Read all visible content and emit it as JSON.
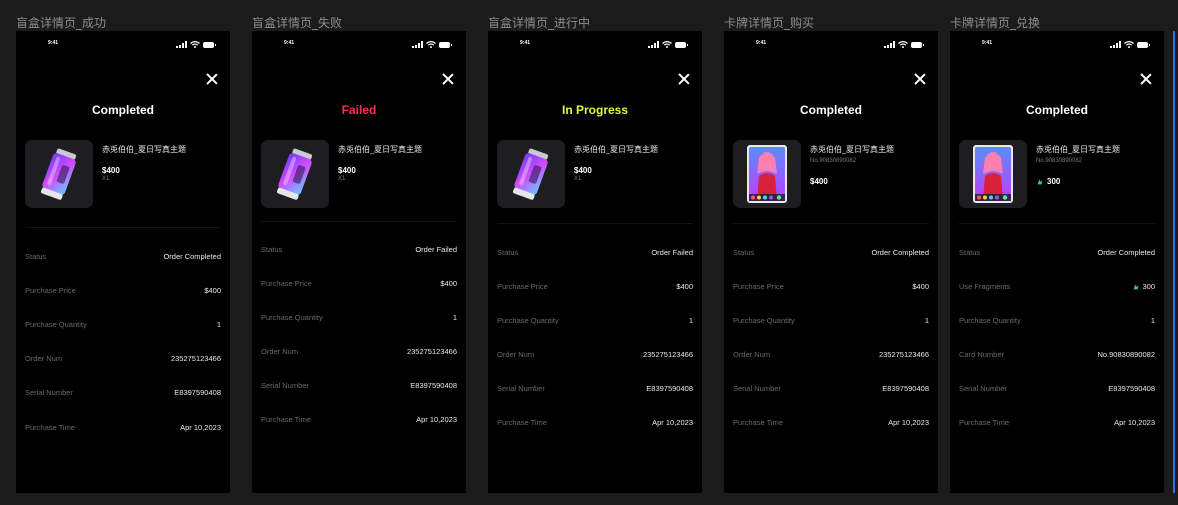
{
  "frames": [
    {
      "label": "盲盒详情页_成功",
      "time": "9:41",
      "title": "Completed",
      "title_color": "#ffffff",
      "product": {
        "image": "blind-box-can",
        "name": "赤兎伯伯_夏日写真主题",
        "no": "",
        "price": "$400",
        "price_icon": "",
        "qty": "X1"
      },
      "rows": [
        {
          "key": "Status",
          "value": "Order Completed"
        },
        {
          "key": "Purchase Price",
          "value": "$400"
        },
        {
          "key": "Purchase Quantity",
          "value": "1"
        },
        {
          "key": "Order Num",
          "value": "235275123466"
        },
        {
          "key": "Serial Number",
          "value": "E8397590408"
        },
        {
          "key": "Purchase Time",
          "value": "Apr 10,2023"
        }
      ]
    },
    {
      "label": "盲盒详情页_失败",
      "time": "9:41",
      "title": "Failed",
      "title_color": "#ff2d55",
      "product": {
        "image": "blind-box-can",
        "name": "赤兎伯伯_夏日写真主题",
        "no": "",
        "price": "$400",
        "price_icon": "",
        "qty": "X1"
      },
      "rows": [
        {
          "key": "Status",
          "value": "Order Failed"
        },
        {
          "key": "Purchase Price",
          "value": "$400"
        },
        {
          "key": "Purchase Quantity",
          "value": "1"
        },
        {
          "key": "Order Num",
          "value": "235275123466"
        },
        {
          "key": "Serial Number",
          "value": "E8397590408"
        },
        {
          "key": "Purchase Time",
          "value": "Apr 10,2023"
        }
      ]
    },
    {
      "label": "盲盒详情页_进行中",
      "time": "9:41",
      "title": "In Progress",
      "title_color": "#d9ff3a",
      "product": {
        "image": "blind-box-can",
        "name": "赤兎伯伯_夏日写真主题",
        "no": "",
        "price": "$400",
        "price_icon": "",
        "qty": "X1"
      },
      "rows": [
        {
          "key": "Status",
          "value": "Order Failed"
        },
        {
          "key": "Purchase Price",
          "value": "$400"
        },
        {
          "key": "Purchase Quantity",
          "value": "1"
        },
        {
          "key": "Order Num",
          "value": "235275123466"
        },
        {
          "key": "Serial Number",
          "value": "E8397590408"
        },
        {
          "key": "Purchase Time",
          "value": "Apr 10,2023"
        }
      ]
    },
    {
      "label": "卡牌详情页_购买",
      "time": "9:41",
      "title": "Completed",
      "title_color": "#ffffff",
      "product": {
        "image": "character-card",
        "name": "赤兎伯伯_夏日写真主题",
        "no": "No.90830890082",
        "price": "$400",
        "price_icon": "",
        "qty": ""
      },
      "rows": [
        {
          "key": "Status",
          "value": "Order Completed"
        },
        {
          "key": "Purchase Price",
          "value": "$400"
        },
        {
          "key": "Purchase Quantity",
          "value": "1"
        },
        {
          "key": "Order Num",
          "value": "235275123466"
        },
        {
          "key": "Serial Number",
          "value": "E8397590408"
        },
        {
          "key": "Purchase Time",
          "value": "Apr 10,2023"
        }
      ]
    },
    {
      "label": "卡牌详情页_兑换",
      "time": "9:41",
      "title": "Completed",
      "title_color": "#ffffff",
      "product": {
        "image": "character-card",
        "name": "赤兎伯伯_夏日写真主题",
        "no": "No.90830890082",
        "price": "300",
        "price_icon": "fragment-icon",
        "qty": ""
      },
      "rows": [
        {
          "key": "Status",
          "value": "Order Completed"
        },
        {
          "key": "Use Fragments",
          "value": "300",
          "icon": "fragment-icon"
        },
        {
          "key": "Purchase Quantity",
          "value": "1"
        },
        {
          "key": "Card Number",
          "value": "No.90830890082"
        },
        {
          "key": "Serial Number",
          "value": "E8397590408"
        },
        {
          "key": "Purchase Time",
          "value": "Apr 10,2023"
        }
      ]
    }
  ],
  "colors": {
    "accent_green": "#39d353",
    "failed_red": "#ff2d55",
    "progress_yellow": "#d9ff3a"
  }
}
